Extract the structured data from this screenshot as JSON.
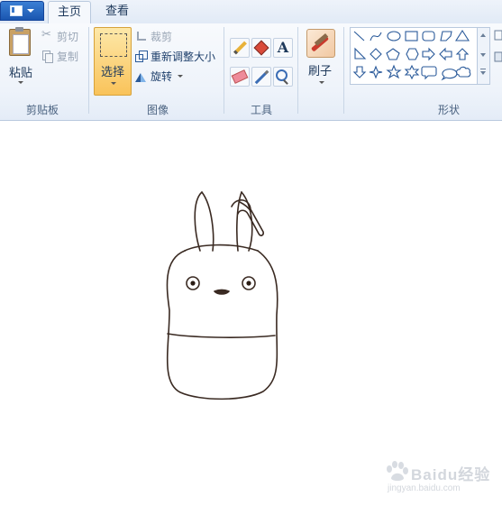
{
  "tabs": {
    "home": "主页",
    "view": "查看"
  },
  "clipboard_group": {
    "paste": "粘贴",
    "cut": "剪切",
    "copy": "复制",
    "label": "剪贴板"
  },
  "image_group": {
    "select": "选择",
    "crop": "裁剪",
    "resize": "重新调整大小",
    "rotate": "旋转",
    "label": "图像"
  },
  "tools_group": {
    "label": "工具",
    "tools": [
      "pencil-icon",
      "fill-icon",
      "text-icon",
      "eraser-icon",
      "color-picker-icon",
      "magnifier-icon"
    ]
  },
  "brush_group": {
    "brush": "刷子"
  },
  "shapes_group": {
    "label": "形状",
    "shapes": [
      "line",
      "curve",
      "oval",
      "rectangle",
      "rounded-rectangle",
      "polygon",
      "triangle",
      "right-triangle",
      "diamond",
      "pentagon",
      "hexagon",
      "right-arrow",
      "left-arrow",
      "up-arrow",
      "down-arrow",
      "four-point-star",
      "five-point-star",
      "six-point-star",
      "rounded-callout",
      "oval-callout",
      "cloud-callout"
    ]
  },
  "watermark": {
    "text": "Baidu经验",
    "sub": "jingyan.baidu.com"
  },
  "colors": {
    "accent": "#1a56b0",
    "select_bg": "#f9c35a",
    "ink": "#3a2a22"
  }
}
